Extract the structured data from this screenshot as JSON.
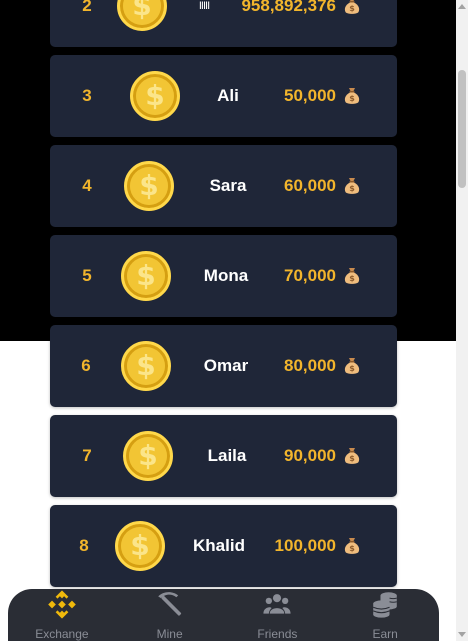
{
  "leaderboard": {
    "currency_icon": "dollar-coin-icon",
    "amount_icon": "money-bag-icon",
    "rows": [
      {
        "rank": "2",
        "name": "IIIII",
        "amount": "958,892,376"
      },
      {
        "rank": "3",
        "name": "Ali",
        "amount": "50,000"
      },
      {
        "rank": "4",
        "name": "Sara",
        "amount": "60,000"
      },
      {
        "rank": "5",
        "name": "Mona",
        "amount": "70,000"
      },
      {
        "rank": "6",
        "name": "Omar",
        "amount": "80,000"
      },
      {
        "rank": "7",
        "name": "Laila",
        "amount": "90,000"
      },
      {
        "rank": "8",
        "name": "Khalid",
        "amount": "100,000"
      }
    ]
  },
  "coin_symbol": "$",
  "nav": {
    "items": [
      {
        "label": "Exchange",
        "icon": "binance-icon",
        "active": true
      },
      {
        "label": "Mine",
        "icon": "pickaxe-icon",
        "active": false
      },
      {
        "label": "Friends",
        "icon": "friends-icon",
        "active": false
      },
      {
        "label": "Earn",
        "icon": "coins-stack-icon",
        "active": false
      }
    ]
  },
  "colors": {
    "card_bg": "#1f2638",
    "accent_gold": "#f2b52c",
    "nav_bg": "#2a2d35",
    "nav_text": "#8a8d96"
  }
}
